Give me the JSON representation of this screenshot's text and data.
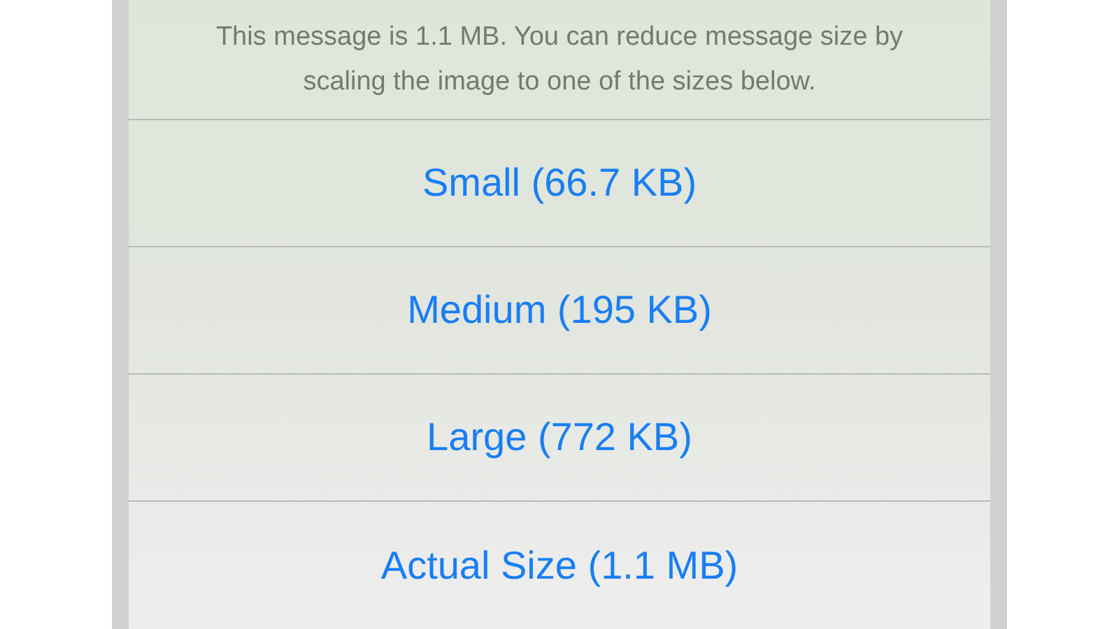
{
  "sheet": {
    "message": "This message is 1.1 MB. You can reduce message size by scaling the image to one of the sizes below.",
    "options": [
      {
        "label": "Small (66.7 KB)"
      },
      {
        "label": "Medium (195 KB)"
      },
      {
        "label": "Large (772 KB)"
      },
      {
        "label": "Actual Size (1.1 MB)"
      }
    ]
  }
}
